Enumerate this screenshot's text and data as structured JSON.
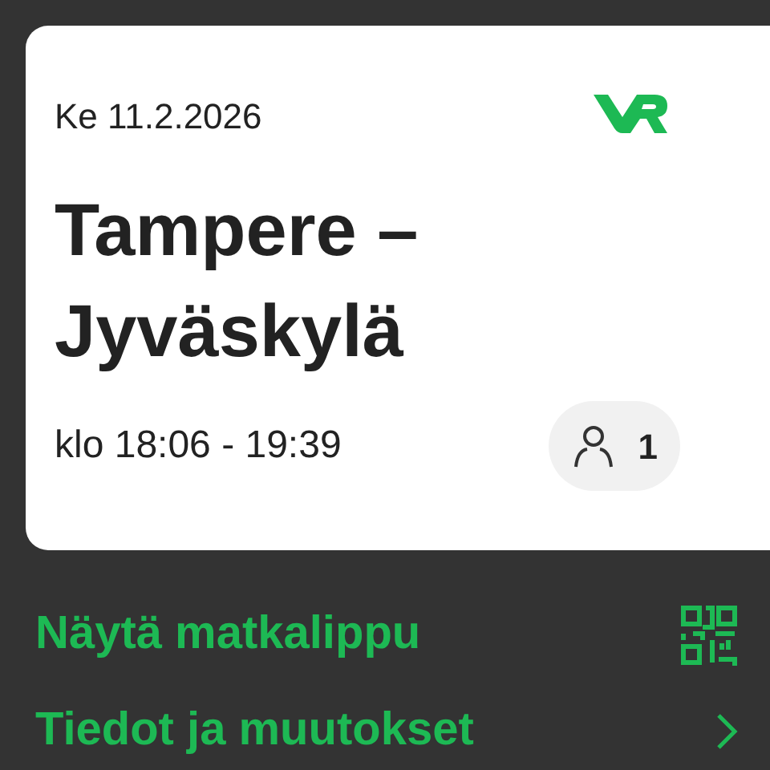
{
  "ticket": {
    "date": "Ke 11.2.2026",
    "title": "Tampere – Jyväskylä",
    "time": "klo 18:06 - 19:39",
    "passengers": "1"
  },
  "actions": [
    {
      "kind": "qr",
      "label": "Näytä matkalippu"
    },
    {
      "kind": "link",
      "label": "Tiedot ja muutokset"
    }
  ]
}
